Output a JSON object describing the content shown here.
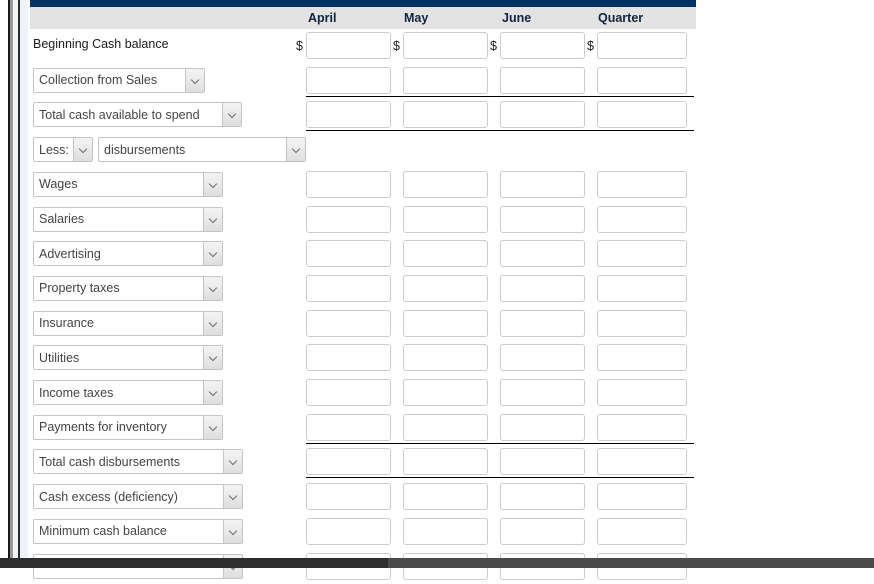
{
  "theme": {
    "header_bar_color": "#003366",
    "header_row_color": "#e3e3e3",
    "rule_color": "#000000",
    "control_border": "#c4c4c4",
    "input_border": "#cccccc"
  },
  "table": {
    "columns": [
      {
        "label": "April"
      },
      {
        "label": "May"
      },
      {
        "label": "June"
      },
      {
        "label": "Quarter"
      }
    ],
    "currency_symbol": "$",
    "rows": [
      {
        "id": "beginning-cash-balance",
        "kind": "text",
        "label": "Beginning Cash balance",
        "show_currency": true,
        "has_inputs": true,
        "rule_below": false
      },
      {
        "id": "collection-from-sales",
        "kind": "select",
        "label": "Collection from Sales",
        "show_currency": false,
        "has_inputs": true,
        "rule_below": true
      },
      {
        "id": "total-cash-available-to-spend",
        "kind": "select",
        "label": "Total cash available to spend",
        "show_currency": false,
        "has_inputs": true,
        "rule_below": true
      },
      {
        "id": "less-disbursements",
        "kind": "select-pair",
        "label": "Less:",
        "label2": "disbursements",
        "show_currency": false,
        "has_inputs": false,
        "rule_below": false
      },
      {
        "id": "wages",
        "kind": "select",
        "label": "Wages",
        "show_currency": false,
        "has_inputs": true,
        "rule_below": false
      },
      {
        "id": "salaries",
        "kind": "select",
        "label": "Salaries",
        "show_currency": false,
        "has_inputs": true,
        "rule_below": false
      },
      {
        "id": "advertising",
        "kind": "select",
        "label": "Advertising",
        "show_currency": false,
        "has_inputs": true,
        "rule_below": false
      },
      {
        "id": "property-taxes",
        "kind": "select",
        "label": "Property taxes",
        "show_currency": false,
        "has_inputs": true,
        "rule_below": false
      },
      {
        "id": "insurance",
        "kind": "select",
        "label": "Insurance",
        "show_currency": false,
        "has_inputs": true,
        "rule_below": false
      },
      {
        "id": "utilities",
        "kind": "select",
        "label": "Utilities",
        "show_currency": false,
        "has_inputs": true,
        "rule_below": false
      },
      {
        "id": "income-taxes",
        "kind": "select",
        "label": "Income taxes",
        "show_currency": false,
        "has_inputs": true,
        "rule_below": false
      },
      {
        "id": "payments-for-inventory",
        "kind": "select",
        "label": "Payments for inventory",
        "show_currency": false,
        "has_inputs": true,
        "rule_below": true
      },
      {
        "id": "total-cash-disbursements",
        "kind": "select",
        "label": "Total cash disbursements",
        "show_currency": false,
        "has_inputs": true,
        "rule_below": true
      },
      {
        "id": "cash-excess-deficiency",
        "kind": "select",
        "label": "Cash excess (deficiency)",
        "show_currency": false,
        "has_inputs": true,
        "rule_below": false
      },
      {
        "id": "minimum-cash-balance",
        "kind": "select",
        "label": "Minimum cash balance",
        "show_currency": false,
        "has_inputs": true,
        "rule_below": false
      },
      {
        "id": "next-row-partial",
        "kind": "select",
        "label": "",
        "show_currency": false,
        "has_inputs": true,
        "rule_below": false
      }
    ]
  },
  "input_placeholder": ""
}
